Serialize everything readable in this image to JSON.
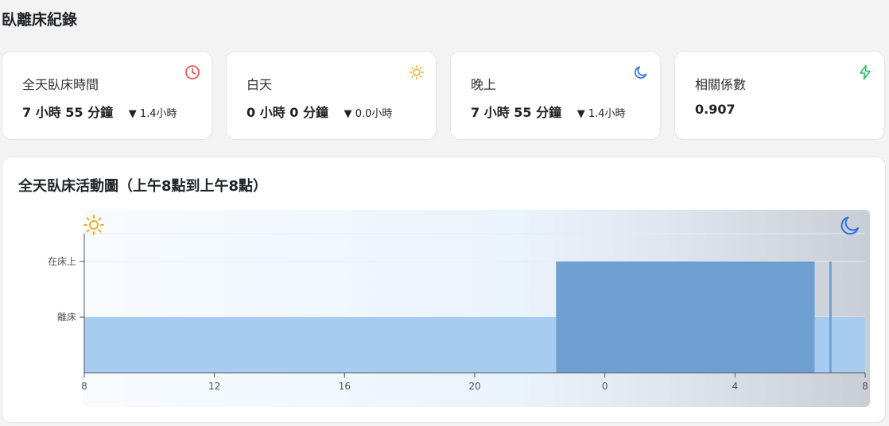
{
  "page": {
    "title": "臥離床紀錄"
  },
  "stats": [
    {
      "label": "全天臥床時間",
      "value": "7 小時 55 分鐘",
      "change": "▼ 1.4小時",
      "icon": "clock-icon",
      "color": "#ef4444"
    },
    {
      "label": "白天",
      "value": "0 小時 0 分鐘",
      "change": "▼ 0.0小時",
      "icon": "sun-icon",
      "color": "#f2b01e"
    },
    {
      "label": "晚上",
      "value": "7 小時 55 分鐘",
      "change": "▼ 1.4小時",
      "icon": "moon-icon",
      "color": "#2f6fe0"
    },
    {
      "label": "相關係數",
      "value": "0.907",
      "change": "",
      "icon": "bolt-icon",
      "color": "#22c55e"
    }
  ],
  "chart": {
    "title": "全天臥床活動圖（上午8點到上午8點）"
  },
  "chart_data": {
    "type": "area",
    "title": "全天臥床活動圖（上午8點到上午8點）",
    "x_domain": [
      8,
      32
    ],
    "x_ticks": [
      {
        "value": 8,
        "label": "8"
      },
      {
        "value": 12,
        "label": "12"
      },
      {
        "value": 16,
        "label": "16"
      },
      {
        "value": 20,
        "label": "20"
      },
      {
        "value": 24,
        "label": "0"
      },
      {
        "value": 28,
        "label": "4"
      },
      {
        "value": 32,
        "label": "8"
      }
    ],
    "y_categories": [
      "離床",
      "在床上"
    ],
    "segments": [
      {
        "start": 8.0,
        "end": 22.5,
        "state": "離床"
      },
      {
        "start": 22.5,
        "end": 30.45,
        "state": "在床上"
      },
      {
        "start": 30.45,
        "end": 30.9,
        "state": "離床"
      },
      {
        "start": 30.9,
        "end": 30.97,
        "state": "在床上"
      },
      {
        "start": 30.97,
        "end": 32.0,
        "state": "離床"
      }
    ],
    "day_icon": "sun-icon",
    "night_icon": "moon-icon",
    "colors": {
      "out_of_bed": "#a6ccf0",
      "in_bed": "#6d9fd0",
      "day_icon": "#f2b01e",
      "night_icon": "#2f6fe0"
    },
    "grid": true
  }
}
